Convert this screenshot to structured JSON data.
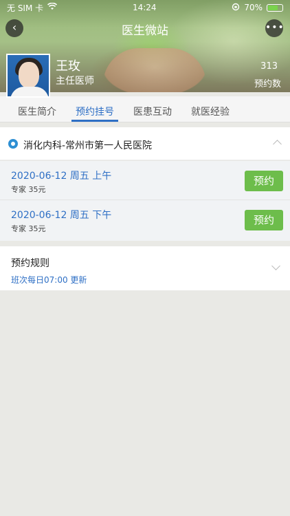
{
  "status_bar": {
    "carrier": "无 SIM 卡",
    "time": "14:24",
    "battery": "70%",
    "battery_level": 0.7
  },
  "nav": {
    "title": "医生微站",
    "back_icon": "chevron-left-icon",
    "more_icon": "more-icon"
  },
  "doctor": {
    "name": "王玫",
    "title": "主任医师",
    "appointment_count": "313",
    "appointment_count_label": "预约数"
  },
  "tabs": [
    {
      "label": "医生简介",
      "active": false
    },
    {
      "label": "预约挂号",
      "active": true
    },
    {
      "label": "医患互动",
      "active": false
    },
    {
      "label": "就医经验",
      "active": false
    }
  ],
  "department": {
    "name": "消化内科-常州市第一人民医院"
  },
  "slots": [
    {
      "date": "2020-06-12 周五   上午",
      "info": "专家   35元",
      "button": "预约"
    },
    {
      "date": "2020-06-12 周五   下午",
      "info": "专家   35元",
      "button": "预约"
    }
  ],
  "rules": {
    "title": "预约规则",
    "subtitle": "班次每日07:00 更新"
  },
  "colors": {
    "accent": "#2e6fc5",
    "book_button": "#6dbd4b",
    "battery": "#7ad34d"
  }
}
